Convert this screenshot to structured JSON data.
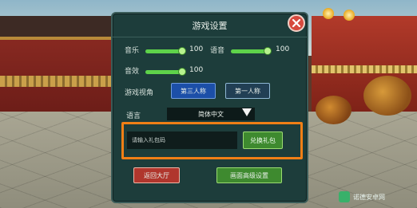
{
  "dialog": {
    "title": "游戏设置",
    "music": {
      "label": "音乐",
      "value": "100",
      "level_percent": 100
    },
    "voice": {
      "label": "语音",
      "value": "100",
      "level_percent": 100
    },
    "sfx": {
      "label": "音效",
      "value": "100",
      "level_percent": 100
    },
    "view": {
      "label": "游戏视角",
      "options": [
        "第三人称",
        "第一人称"
      ],
      "selected": "第三人称"
    },
    "language": {
      "label": "语言",
      "selected": "简体中文"
    },
    "gift": {
      "placeholder": "请输入礼包码",
      "redeem_label": "兑换礼包"
    },
    "back_label": "返回大厅",
    "reset_label": "画面高级设置"
  },
  "watermark": {
    "text": "诺德安卓网"
  },
  "colors": {
    "dialog_bg": "#1d3d3b",
    "accent_green": "#5ed24a",
    "highlight_orange": "#f07f16",
    "close_red": "#d64a3e",
    "active_blue": "#1c4fa8"
  }
}
